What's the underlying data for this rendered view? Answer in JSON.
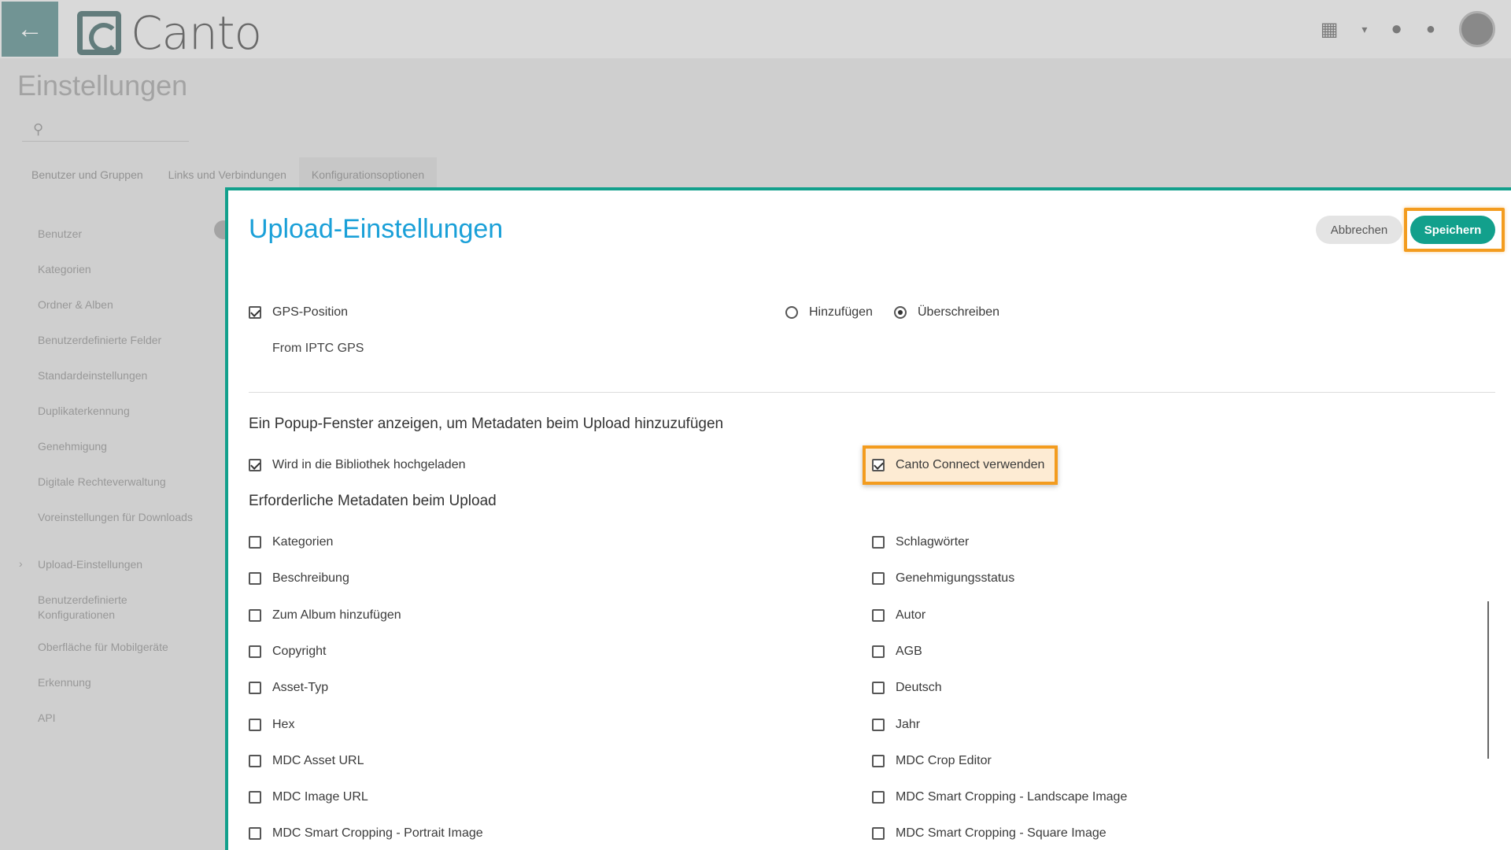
{
  "header": {
    "back_icon": "←",
    "logo_text": "Canto"
  },
  "background": {
    "page_title": "Einstellungen",
    "tabs": [
      "Benutzer und Gruppen",
      "Links und Verbindungen",
      "Konfigurationsoptionen"
    ],
    "sidebar": [
      "Benutzer",
      "Kategorien",
      "Ordner & Alben",
      "Benutzerdefinierte Felder",
      "Standardeinstellungen",
      "Duplikaterkennung",
      "Genehmigung",
      "Digitale Rechteverwaltung",
      "Voreinstellungen für Downloads",
      "Upload-Einstellungen",
      "Benutzerdefinierte Konfigurationen",
      "Oberfläche für Mobilgeräte",
      "Erkennung",
      "API"
    ]
  },
  "dialog": {
    "title": "Upload-Einstellungen",
    "cancel_label": "Abbrechen",
    "save_label": "Speichern",
    "gps": {
      "label": "GPS-Position",
      "checked": true,
      "radio_add": "Hinzufügen",
      "radio_overwrite": "Überschreiben",
      "source": "From IPTC GPS"
    },
    "popup_heading": "Ein Popup-Fenster anzeigen, um Metadaten beim Upload hinzuzufügen",
    "library_upload_label": "Wird in die Bibliothek hochgeladen",
    "canto_connect_label": "Canto Connect verwenden",
    "required_heading": "Erforderliche Metadaten beim Upload",
    "fields_left": [
      "Kategorien",
      "Beschreibung",
      "Zum Album hinzufügen",
      "Copyright",
      "Asset-Typ",
      "Hex",
      "MDC Asset URL",
      "MDC Image URL",
      "MDC Smart Cropping - Portrait Image"
    ],
    "fields_right": [
      "Schlagwörter",
      "Genehmigungsstatus",
      "Autor",
      "AGB",
      "Deutsch",
      "Jahr",
      "MDC Crop Editor",
      "MDC Smart Cropping - Landscape Image",
      "MDC Smart Cropping - Square Image"
    ]
  },
  "colors": {
    "accent": "#12a08c",
    "title_blue": "#1aa0d8",
    "highlight": "#f39c1f"
  }
}
